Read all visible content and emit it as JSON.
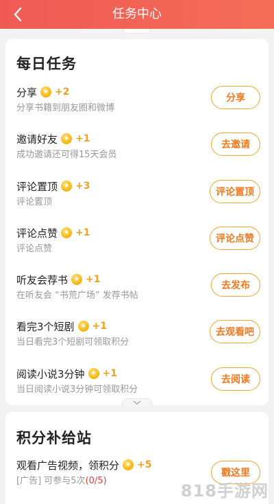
{
  "header": {
    "title": "任务中心",
    "bg_color": "#ef5a55"
  },
  "daily": {
    "title": "每日任务",
    "tasks": [
      {
        "name": "分享",
        "reward": "+2",
        "desc": "分享书籍到朋友圈和微博",
        "button": "分享"
      },
      {
        "name": "邀请好友",
        "reward": "+1",
        "desc": "成功邀请还可得15天会员",
        "button": "去邀请"
      },
      {
        "name": "评论置顶",
        "reward": "+3",
        "desc": "评论置顶",
        "button": "评论置顶"
      },
      {
        "name": "评论点赞",
        "reward": "+1",
        "desc": "评论点赞",
        "button": "评论点赞"
      },
      {
        "name": "听友会荐书",
        "reward": "+1",
        "desc": "在听友会 “书荒广场” 发荐书帖",
        "button": "去发布"
      },
      {
        "name": "看完3个短剧",
        "reward": "+1",
        "desc": "当日看完3个短剧可领取积分",
        "button": "去观看吧"
      },
      {
        "name": "阅读小说3分钟",
        "reward": "+1",
        "desc": "当日阅读小说3分钟可领取积分",
        "button": "去阅读"
      }
    ]
  },
  "points": {
    "title": "积分补给站",
    "task": {
      "name": "观看广告视频，领积分",
      "reward": "+5",
      "ad_label": "[广告]",
      "desc": "可参与5次",
      "count": "(0/5)",
      "button": "戳这里"
    }
  },
  "watermark": "818手游网",
  "colors": {
    "accent": "#f07a1f",
    "button_border": "#f2a32a",
    "reward": "#f0a11d",
    "count_red": "#e33a3a"
  }
}
